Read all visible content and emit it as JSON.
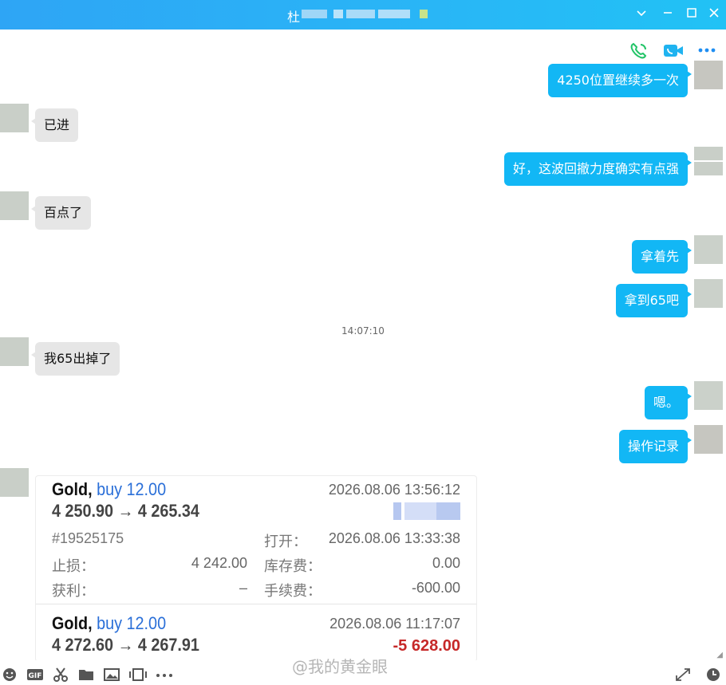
{
  "window": {
    "title_name": "杜"
  },
  "messages": [
    {
      "from": "me",
      "text": "4250位置继续多一次"
    },
    {
      "from": "other",
      "text": "已进"
    },
    {
      "from": "me",
      "text": "好，这波回撤力度确实有点强"
    },
    {
      "from": "other",
      "text": "百点了"
    },
    {
      "from": "me",
      "text": "拿着先"
    },
    {
      "from": "me",
      "text": "拿到65吧"
    },
    {
      "from": "other",
      "text": "我65出掉了"
    },
    {
      "from": "me",
      "text": "嗯。"
    },
    {
      "from": "me",
      "text": "操作记录"
    }
  ],
  "time_separator": "14:07:10",
  "trade_card": {
    "trade1": {
      "symbol": "Gold,",
      "side": "buy 12.00",
      "prices": "4 250.90 → 4 265.34",
      "close_time": "2026.08.06 13:56:12",
      "ticket": "#19525175",
      "open_label": "打开：",
      "open_time": "2026.08.06 13:33:38",
      "sl_label": "止损：",
      "sl_value": "4 242.00",
      "swap_label": "库存费：",
      "swap_value": "0.00",
      "tp_label": "获利：",
      "tp_value": "–",
      "commission_label": "手续费：",
      "commission_value": "-600.00"
    },
    "trade2": {
      "symbol": "Gold,",
      "side": "buy 12.00",
      "prices": "4 272.60 → 4 267.91",
      "close_time": "2026.08.06 11:17:07",
      "profit": "-5 628.00"
    }
  },
  "watermark": "@我的黄金眼",
  "colors": {
    "title_bar": "#29b6f6",
    "outgoing_bubble": "#12b7f5",
    "incoming_bubble": "#e6e6e6",
    "buy_blue": "#2a6fd8",
    "loss_red": "#c62828"
  },
  "icons": {
    "header": [
      "phone-icon",
      "video-call-icon",
      "more-icon"
    ],
    "window": [
      "chevron-down-icon",
      "minimize-icon",
      "maximize-icon",
      "close-icon"
    ],
    "toolbar": [
      "emoji-icon",
      "gif-icon",
      "scissors-icon",
      "folder-icon",
      "image-icon",
      "screen-capture-icon",
      "more-tools-icon",
      "expand-icon",
      "history-icon"
    ]
  }
}
